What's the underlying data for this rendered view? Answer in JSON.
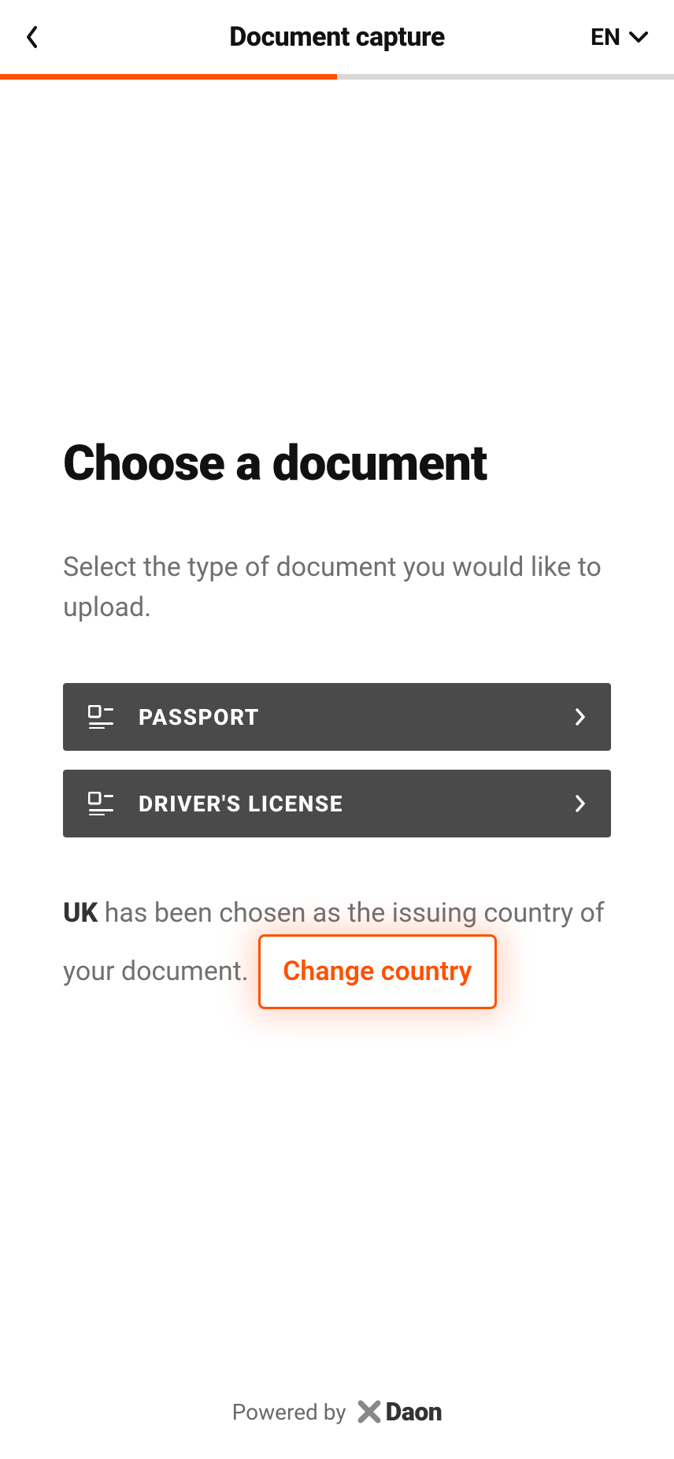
{
  "header": {
    "title": "Document capture",
    "language": "EN"
  },
  "progress": {
    "percent": 50
  },
  "main": {
    "heading": "Choose a document",
    "description": "Select the type of document you would like to upload."
  },
  "options": [
    {
      "id": "passport",
      "label": "PASSPORT",
      "icon": "id-icon"
    },
    {
      "id": "drivers-license",
      "label": "DRIVER'S LICENSE",
      "icon": "id-icon"
    }
  ],
  "country_note": {
    "country_code": "UK",
    "text_after_code": " has been chosen as the issuing country of your document. ",
    "change_link": "Change country"
  },
  "footer": {
    "powered_by": "Powered by",
    "brand": "Daon"
  },
  "colors": {
    "accent": "#ff5000",
    "button_bg": "#4a4a4a",
    "text_muted": "#707070"
  }
}
